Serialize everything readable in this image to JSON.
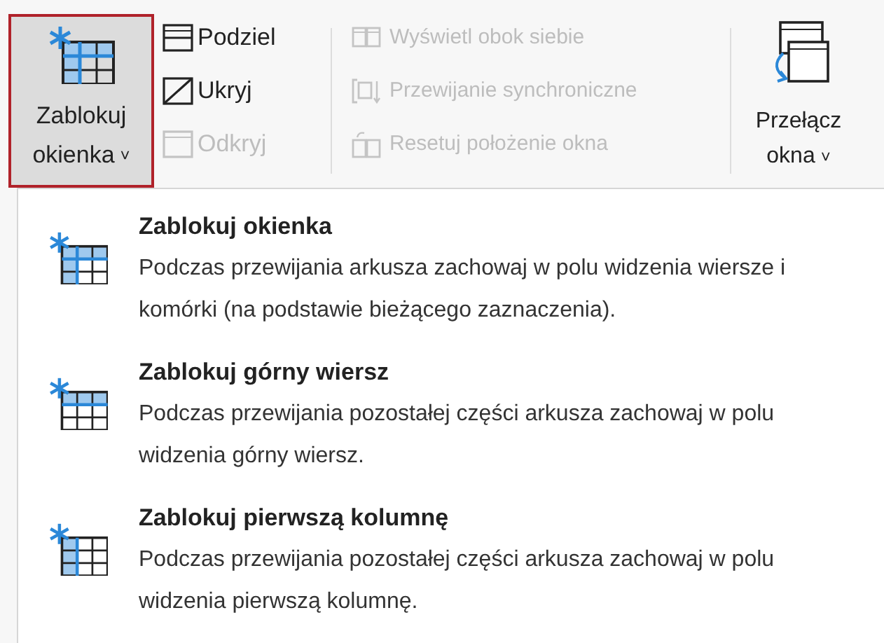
{
  "ribbon": {
    "freeze_button": {
      "label_lines": [
        "Zablokuj",
        "okienka"
      ],
      "caret": "˅",
      "selected": true
    },
    "window_group": [
      {
        "kind": "split",
        "label": "Podziel",
        "disabled": false
      },
      {
        "kind": "hide",
        "label": "Ukryj",
        "disabled": false
      },
      {
        "kind": "unhide",
        "label": "Odkryj",
        "disabled": true
      }
    ],
    "compare_group": [
      {
        "kind": "side-by-side",
        "label": "Wyświetl obok siebie",
        "disabled": true
      },
      {
        "kind": "sync-scroll",
        "label": "Przewijanie synchroniczne",
        "disabled": true
      },
      {
        "kind": "reset-position",
        "label": "Resetuj położenie okna",
        "disabled": true
      }
    ],
    "switch_button": {
      "label_lines": [
        "Przełącz",
        "okna"
      ],
      "caret": "˅"
    }
  },
  "menu": {
    "items": [
      {
        "kind": "panes",
        "title": "Zablokuj okienka",
        "description": "Podczas przewijania arkusza zachowaj w polu widzenia wiersze i komórki (na podstawie bieżącego zaznaczenia)."
      },
      {
        "kind": "top-row",
        "title": "Zablokuj górny wiersz",
        "description": "Podczas przewijania pozostałej części arkusza zachowaj w polu widzenia górny wiersz."
      },
      {
        "kind": "first-column",
        "title": "Zablokuj pierwszą kolumnę",
        "description": "Podczas przewijania pozostałej części arkusza zachowaj w polu widzenia pierwszą kolumnę."
      }
    ]
  }
}
